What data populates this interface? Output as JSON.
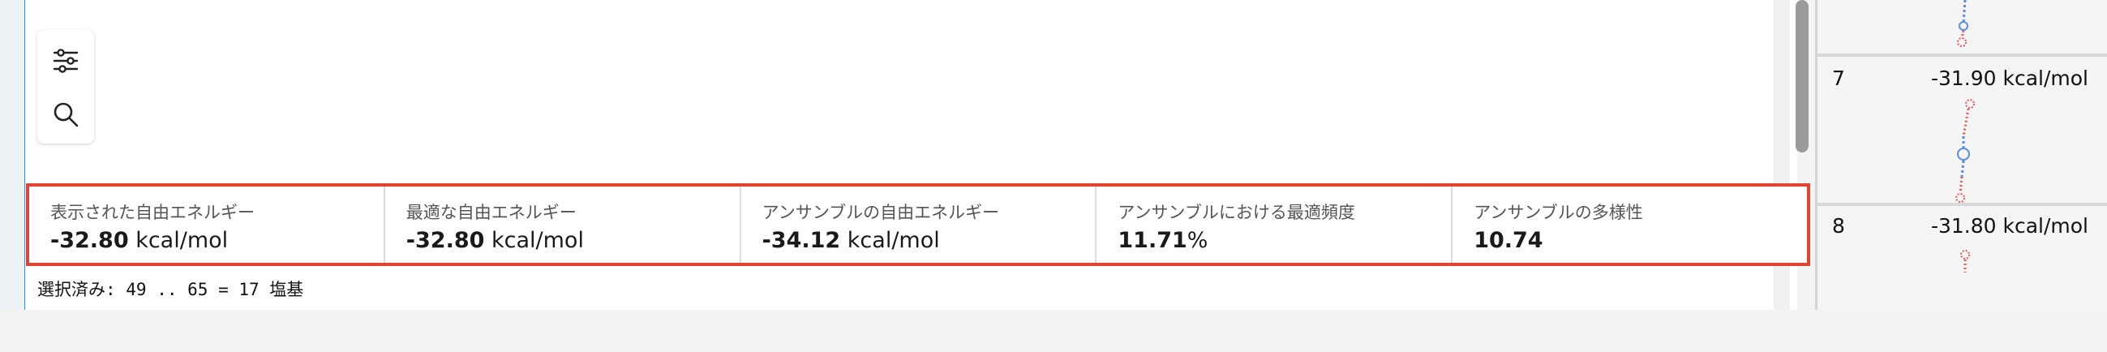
{
  "stats": {
    "displayed": {
      "label": "表示された自由エネルギー",
      "value": "-32.80",
      "unit": "kcal/mol"
    },
    "optimal": {
      "label": "最適な自由エネルギー",
      "value": "-32.80",
      "unit": "kcal/mol"
    },
    "ensemble": {
      "label": "アンサンブルの自由エネルギー",
      "value": "-34.12",
      "unit": "kcal/mol"
    },
    "frequency": {
      "label": "アンサンブルにおける最適頻度",
      "value": "11.71",
      "unit": "%"
    },
    "diversity": {
      "label": "アンサンブルの多様性",
      "value": "10.74"
    }
  },
  "selection": {
    "text": "選択済み: 49 .. 65 = 17 塩基"
  },
  "structures": [
    {
      "index": "7",
      "energy": "-31.90 kcal/mol"
    },
    {
      "index": "8",
      "energy": "-31.80 kcal/mol"
    }
  ],
  "colors": {
    "highlight_border": "#e0452f",
    "paired_blue": "#5a8de0",
    "unpaired_red": "#e05a5a"
  },
  "icons": {
    "filter": "sliders-icon",
    "search": "search-icon"
  }
}
